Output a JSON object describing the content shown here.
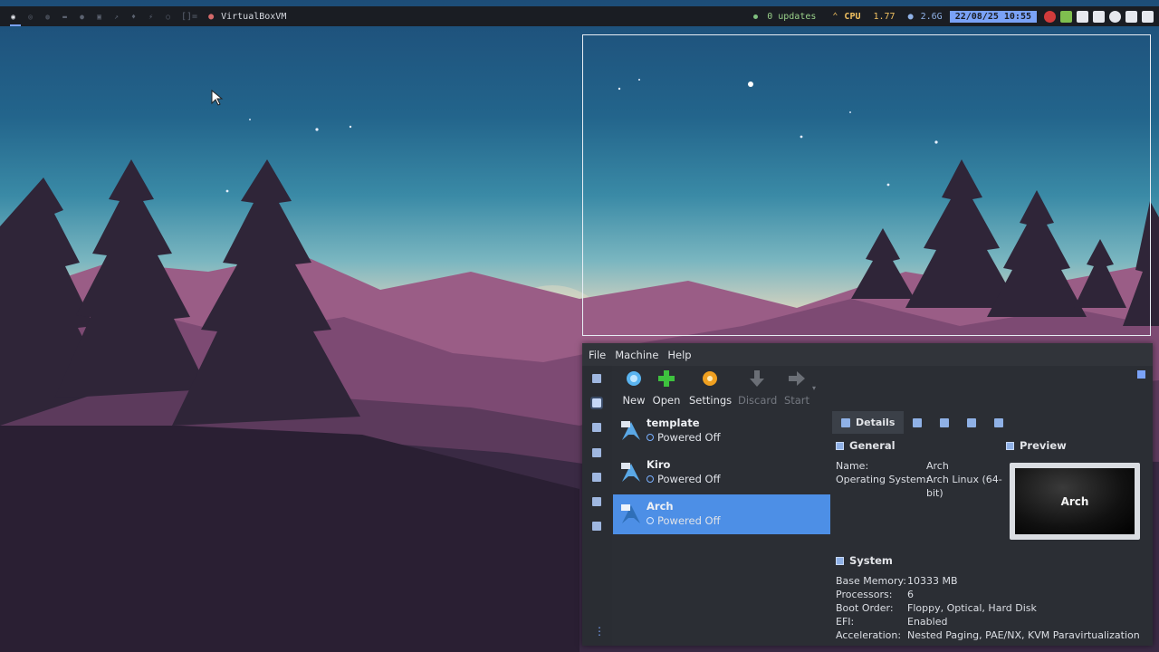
{
  "topbar": {
    "window_title": "VirtualBoxVM",
    "updates": "0 updates",
    "cpu_label": "CPU",
    "cpu_value": "1.77",
    "mem_value": "2.6G",
    "clock": "22/08/25 10:55",
    "layout_indicator": "[]="
  },
  "vbox": {
    "menu": [
      "File",
      "Machine",
      "Help"
    ],
    "toolbar": {
      "new": "New",
      "open": "Open",
      "settings": "Settings",
      "discard": "Discard",
      "start": "Start"
    },
    "vms": [
      {
        "name": "template",
        "state": "Powered Off"
      },
      {
        "name": "Kiro",
        "state": "Powered Off"
      },
      {
        "name": "Arch",
        "state": "Powered Off"
      }
    ],
    "details_tab": "Details",
    "general": {
      "title": "General",
      "name_label": "Name:",
      "name_value": "Arch",
      "os_label": "Operating System:",
      "os_value_line1": "Arch Linux (64-",
      "os_value_line2": "bit)"
    },
    "preview": {
      "title": "Preview",
      "screen_text": "Arch"
    },
    "system": {
      "title": "System",
      "rows": [
        {
          "label": "Base Memory:",
          "value": "10333 MB"
        },
        {
          "label": "Processors:",
          "value": "6"
        },
        {
          "label": "Boot Order:",
          "value": "Floppy, Optical, Hard Disk"
        },
        {
          "label": "EFI:",
          "value": "Enabled"
        },
        {
          "label": "Acceleration:",
          "value": "Nested Paging, PAE/NX, KVM Paravirtualization"
        }
      ]
    }
  },
  "colors": {
    "accent": "#4d8fe6",
    "clock_bg": "#7aa2f7",
    "window_bg": "#2b2e34",
    "topbar_bg": "#1a1d23"
  }
}
